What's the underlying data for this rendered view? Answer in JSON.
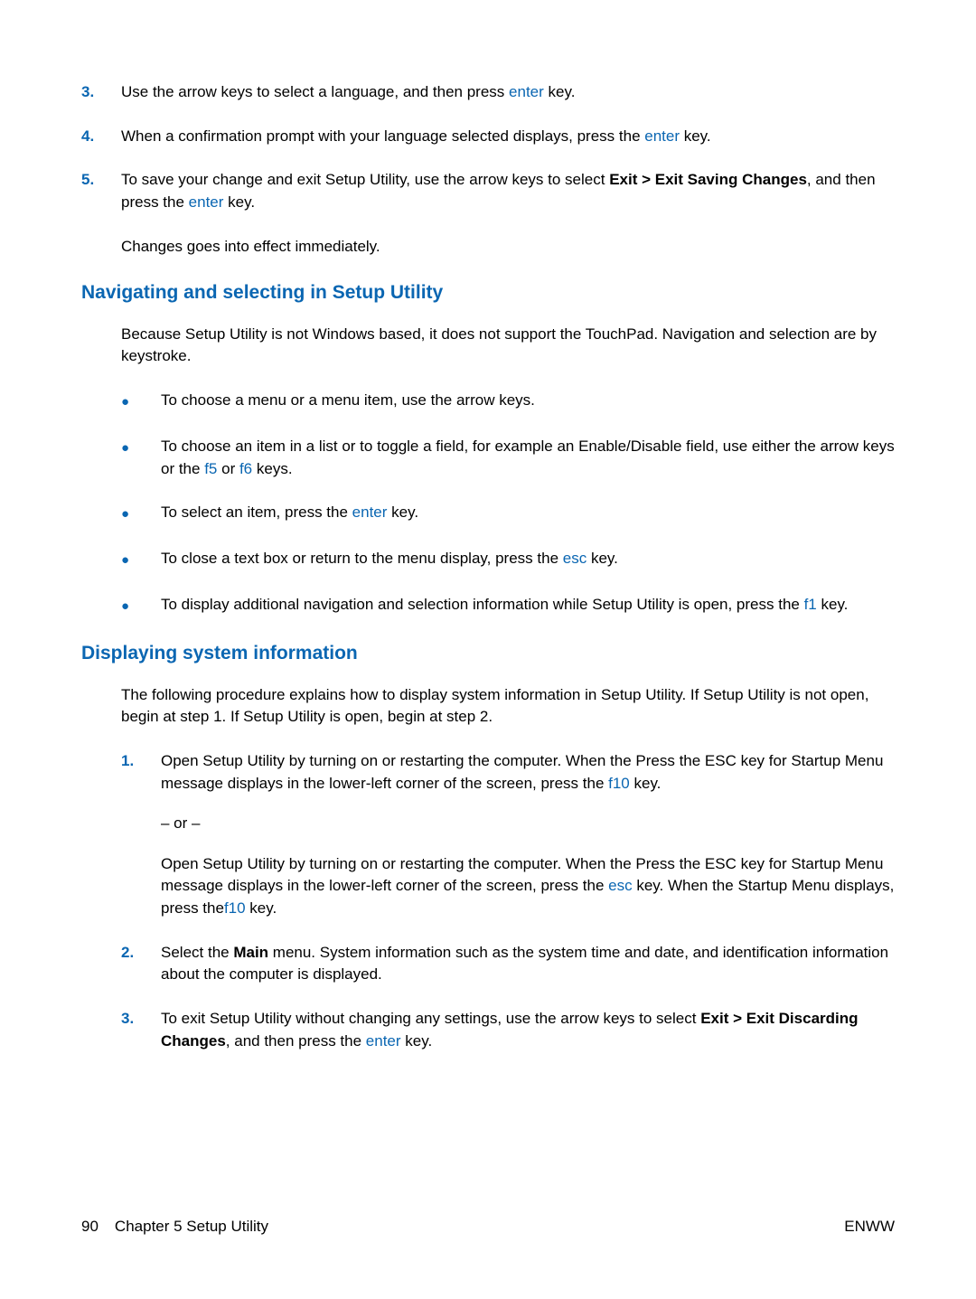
{
  "list1": {
    "items": [
      {
        "num": "3.",
        "t1": "Use the arrow keys to select a language, and then press ",
        "k1": "enter",
        "t2": " key."
      },
      {
        "num": "4.",
        "t1": "When a confirmation prompt with your language selected displays, press the ",
        "k1": "enter",
        "t2": " key."
      },
      {
        "num": "5.",
        "t1": "To save your change and exit Setup Utility, use the arrow keys to select ",
        "b1": "Exit > Exit Saving Changes",
        "t2": ", and then press the ",
        "k1": "enter",
        "t3": " key."
      }
    ],
    "after": "Changes goes into effect immediately."
  },
  "section1": {
    "heading": "Navigating and selecting in Setup Utility",
    "intro": "Because Setup Utility is not Windows based, it does not support the TouchPad. Navigation and selection are by keystroke.",
    "bullets": [
      {
        "t1": "To choose a menu or a menu item, use the arrow keys."
      },
      {
        "t1": "To choose an item in a list or to toggle a field, for example an Enable/Disable field, use either the arrow keys or the ",
        "k1": "f5",
        "t2": " or ",
        "k2": "f6",
        "t3": " keys."
      },
      {
        "t1": "To select an item, press the ",
        "k1": "enter",
        "t2": " key."
      },
      {
        "t1": "To close a text box or return to the menu display, press the ",
        "k1": "esc",
        "t2": " key."
      },
      {
        "t1": "To display additional navigation and selection information while Setup Utility is open, press the ",
        "k1": "f1",
        "t2": " key."
      }
    ]
  },
  "section2": {
    "heading": "Displaying system information",
    "intro": "The following procedure explains how to display system information in Setup Utility. If Setup Utility is not open, begin at step 1. If Setup Utility is open, begin at step 2.",
    "steps": [
      {
        "num": "1.",
        "p1_t1": "Open Setup Utility by turning on or restarting the computer. When the Press the ESC key for Startup Menu message displays in the lower-left corner of the screen, press the ",
        "p1_k1": "f10",
        "p1_t2": " key.",
        "or": "– or –",
        "p2_t1": "Open Setup Utility by turning on or restarting the computer. When the Press the ESC key for Startup Menu message displays in the lower-left corner of the screen, press the ",
        "p2_k1": "esc",
        "p2_t2": " key. When the Startup Menu displays, press the",
        "p2_k2": "f10",
        "p2_t3": " key."
      },
      {
        "num": "2.",
        "t1": "Select the ",
        "b1": "Main",
        "t2": " menu. System information such as the system time and date, and identification information about the computer is displayed."
      },
      {
        "num": "3.",
        "t1": "To exit Setup Utility without changing any settings, use the arrow keys to select ",
        "b1": "Exit > Exit Discarding Changes",
        "t2": ", and then press the ",
        "k1": "enter",
        "t3": " key."
      }
    ]
  },
  "footer": {
    "page": "90",
    "chapter": "Chapter 5   Setup Utility",
    "right": "ENWW"
  }
}
